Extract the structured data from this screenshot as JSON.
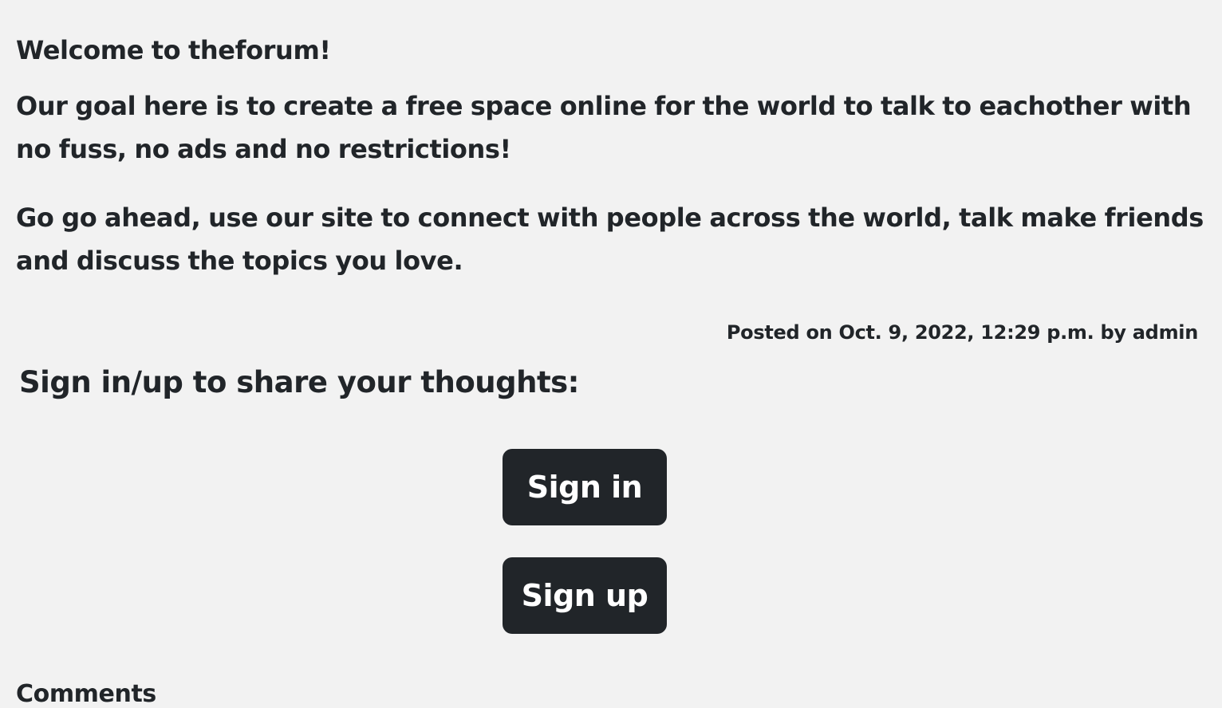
{
  "post": {
    "paragraphs": [
      "Welcome to theforum!",
      "Our goal here is to create a free space online for the world to talk to eachother with no fuss, no ads and no restrictions!",
      "Go go ahead, use our site to connect with people across the world, talk make friends and discuss the topics you love."
    ],
    "meta": "Posted on Oct. 9, 2022, 12:29 p.m. by admin"
  },
  "auth": {
    "prompt": "Sign in/up to share your thoughts:",
    "signin_label": "Sign in",
    "signup_label": "Sign up"
  },
  "comments": {
    "heading": "Comments"
  },
  "colors": {
    "background": "#f2f2f2",
    "text": "#212529",
    "button_bg": "#212529",
    "button_text": "#ffffff"
  }
}
